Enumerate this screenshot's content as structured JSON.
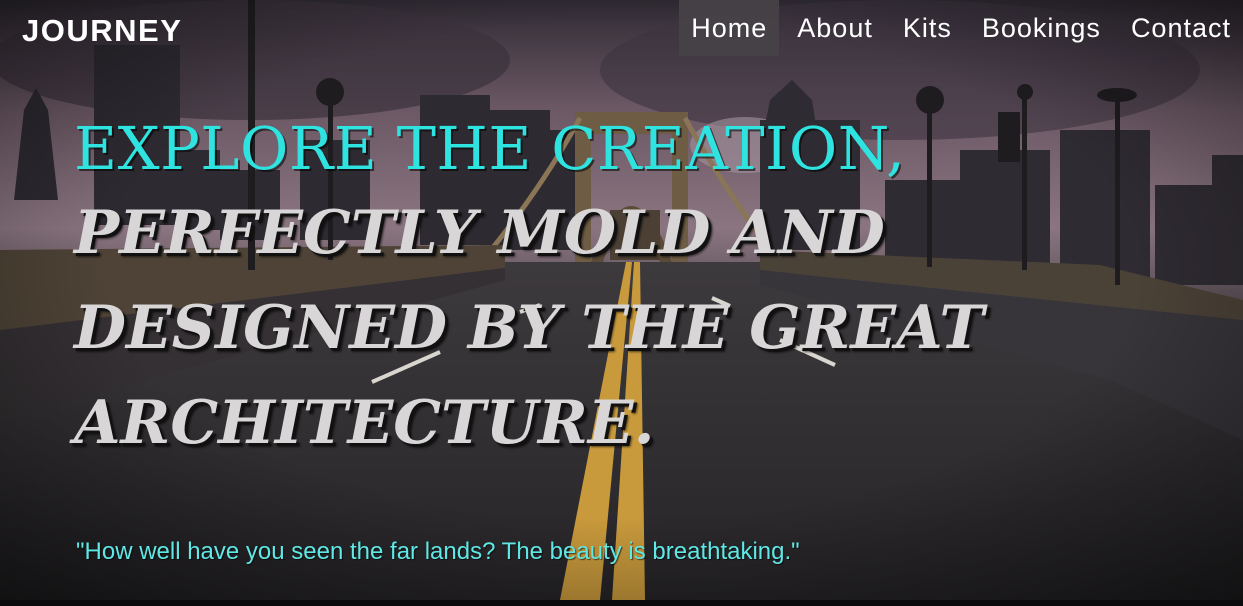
{
  "brand": {
    "name": "JOURNEY"
  },
  "nav": {
    "items": [
      {
        "label": "Home",
        "active": true
      },
      {
        "label": "About",
        "active": false
      },
      {
        "label": "Kits",
        "active": false
      },
      {
        "label": "Bookings",
        "active": false
      },
      {
        "label": "Contact",
        "active": false
      }
    ]
  },
  "hero": {
    "headline_primary": "EXPLORE THE CREATION,",
    "headline_secondary": "PERFECTLY MOLD AND DESIGNED BY THE GREAT ARCHITECTURE.",
    "quote": "\"How well have you seen the far lands? The beauty is breathtaking.\""
  },
  "colors": {
    "accent": "#2ee3e0",
    "quote": "#5fe8e5",
    "headline_secondary": "#d8d6d6",
    "nav_active_bg": "#464246"
  }
}
